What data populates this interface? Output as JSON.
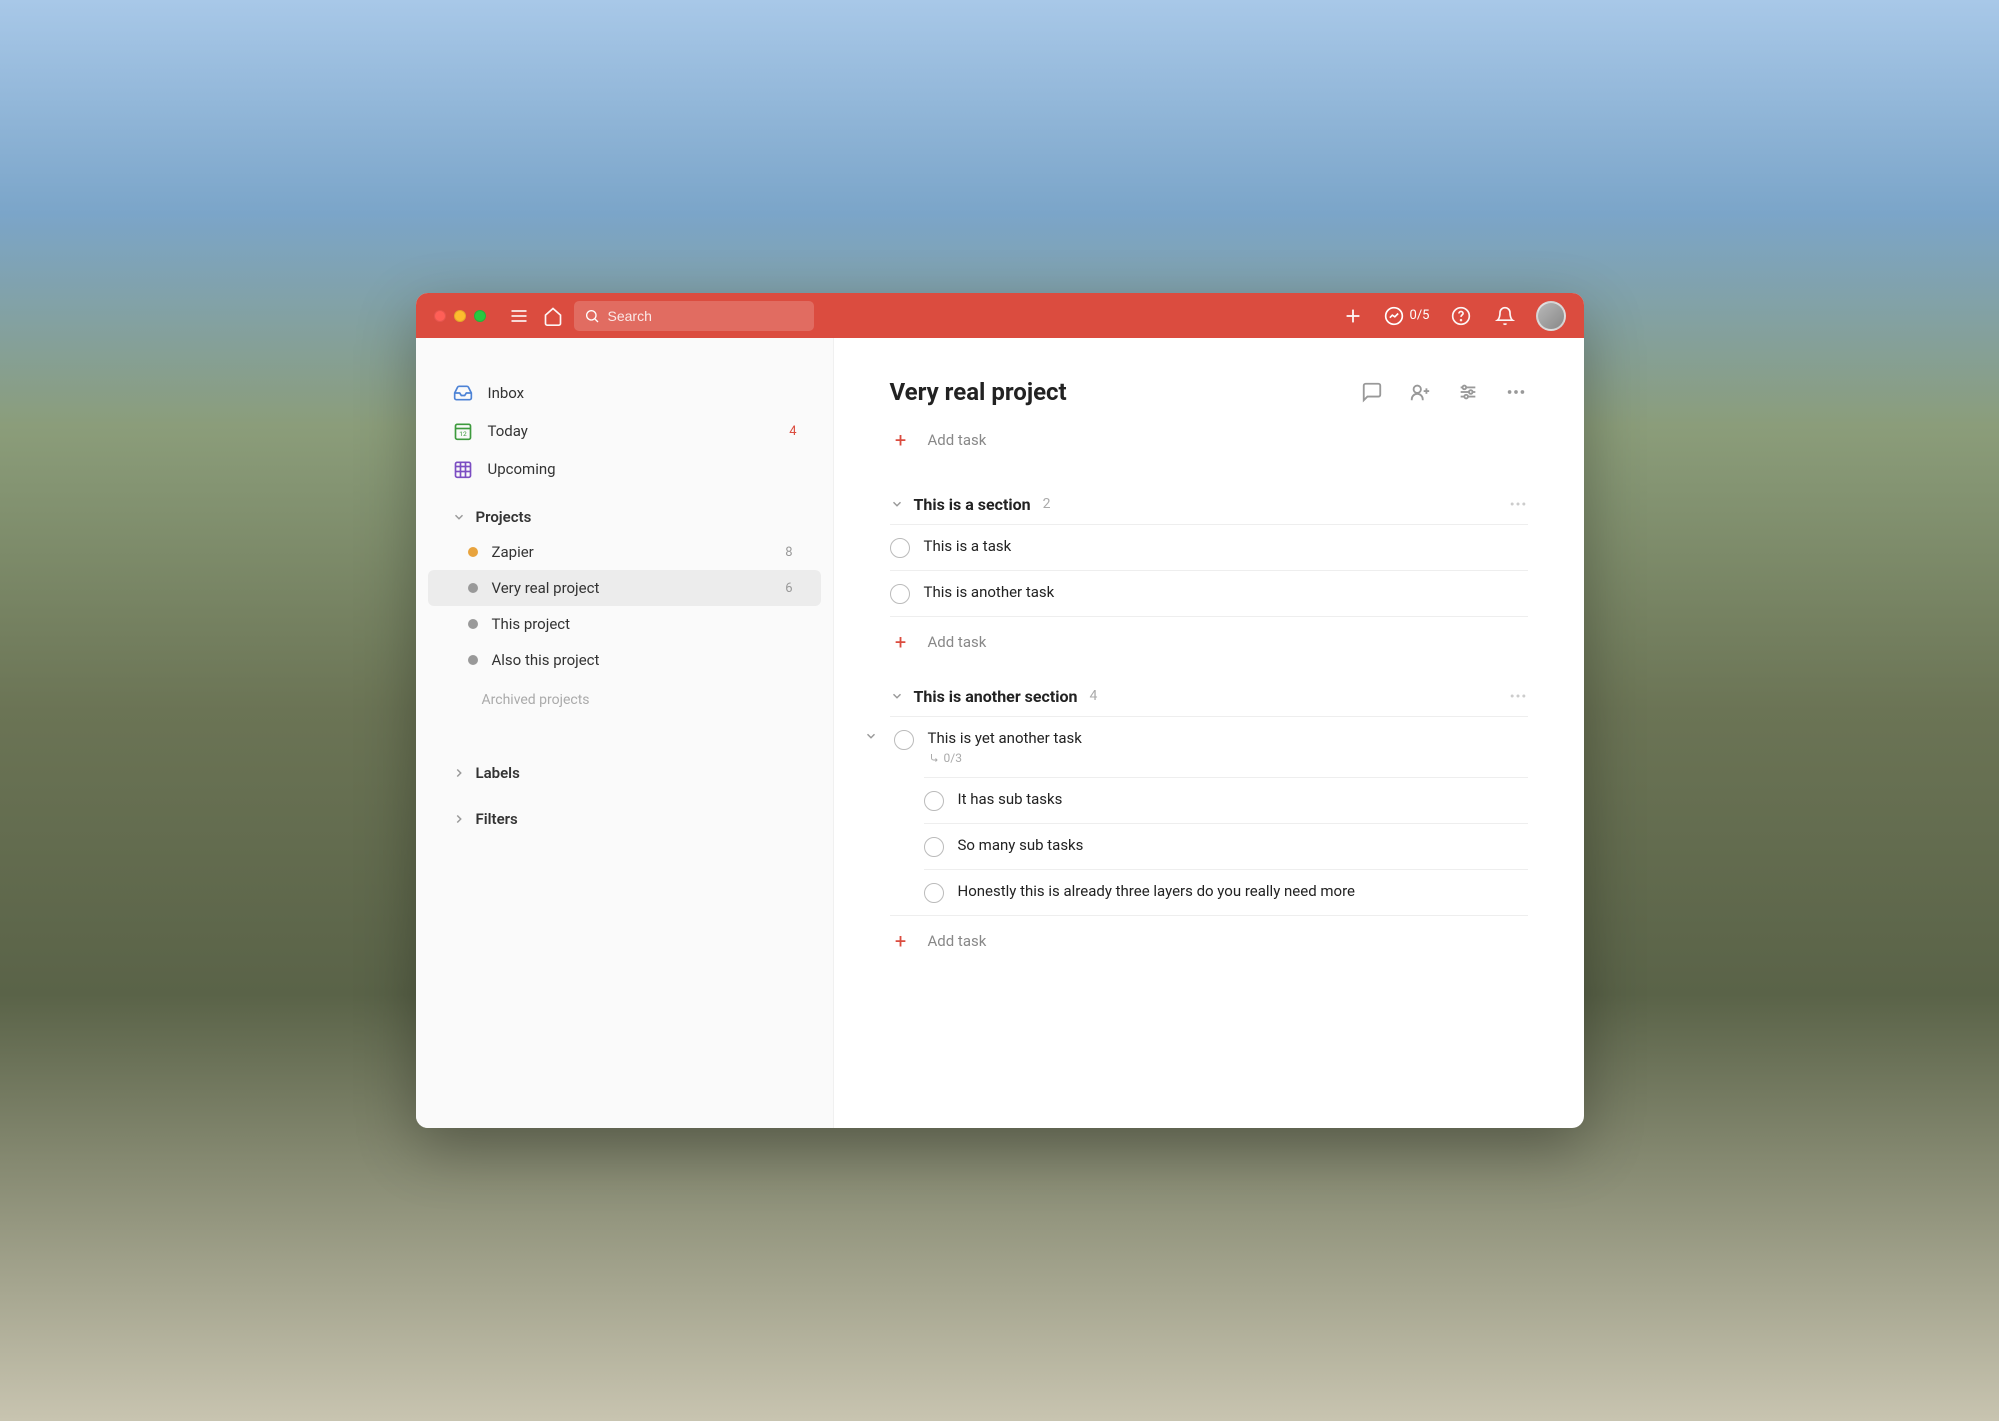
{
  "colors": {
    "accent": "#db4c3f",
    "inbox_icon": "#4d83d6",
    "today_icon": "#3d9a3d",
    "upcoming_icon": "#7b4dc2",
    "project_orange": "#e8a33d",
    "project_gray": "#999999"
  },
  "topbar": {
    "search_placeholder": "Search",
    "productivity_text": "0/5"
  },
  "sidebar": {
    "nav": [
      {
        "key": "inbox",
        "label": "Inbox",
        "count": ""
      },
      {
        "key": "today",
        "label": "Today",
        "count": "4"
      },
      {
        "key": "upcoming",
        "label": "Upcoming",
        "count": ""
      }
    ],
    "projects_label": "Projects",
    "projects": [
      {
        "name": "Zapier",
        "color": "#e8a33d",
        "count": "8",
        "active": false
      },
      {
        "name": "Very real project",
        "color": "#999999",
        "count": "6",
        "active": true
      },
      {
        "name": "This project",
        "color": "#999999",
        "count": "",
        "active": false
      },
      {
        "name": "Also this project",
        "color": "#999999",
        "count": "",
        "active": false
      }
    ],
    "archived_label": "Archived projects",
    "labels_label": "Labels",
    "filters_label": "Filters"
  },
  "main": {
    "title": "Very real project",
    "add_task_label": "Add task",
    "sections": [
      {
        "title": "This is a section",
        "count": "2",
        "tasks": [
          {
            "title": "This is a task"
          },
          {
            "title": "This is another task"
          }
        ]
      },
      {
        "title": "This is another section",
        "count": "4",
        "tasks": [
          {
            "title": "This is yet another task",
            "subtask_meta": "0/3",
            "expandable": true,
            "subtasks": [
              {
                "title": "It has sub tasks"
              },
              {
                "title": "So many sub tasks"
              },
              {
                "title": "Honestly this is already three layers do you really need more"
              }
            ]
          }
        ]
      }
    ]
  }
}
